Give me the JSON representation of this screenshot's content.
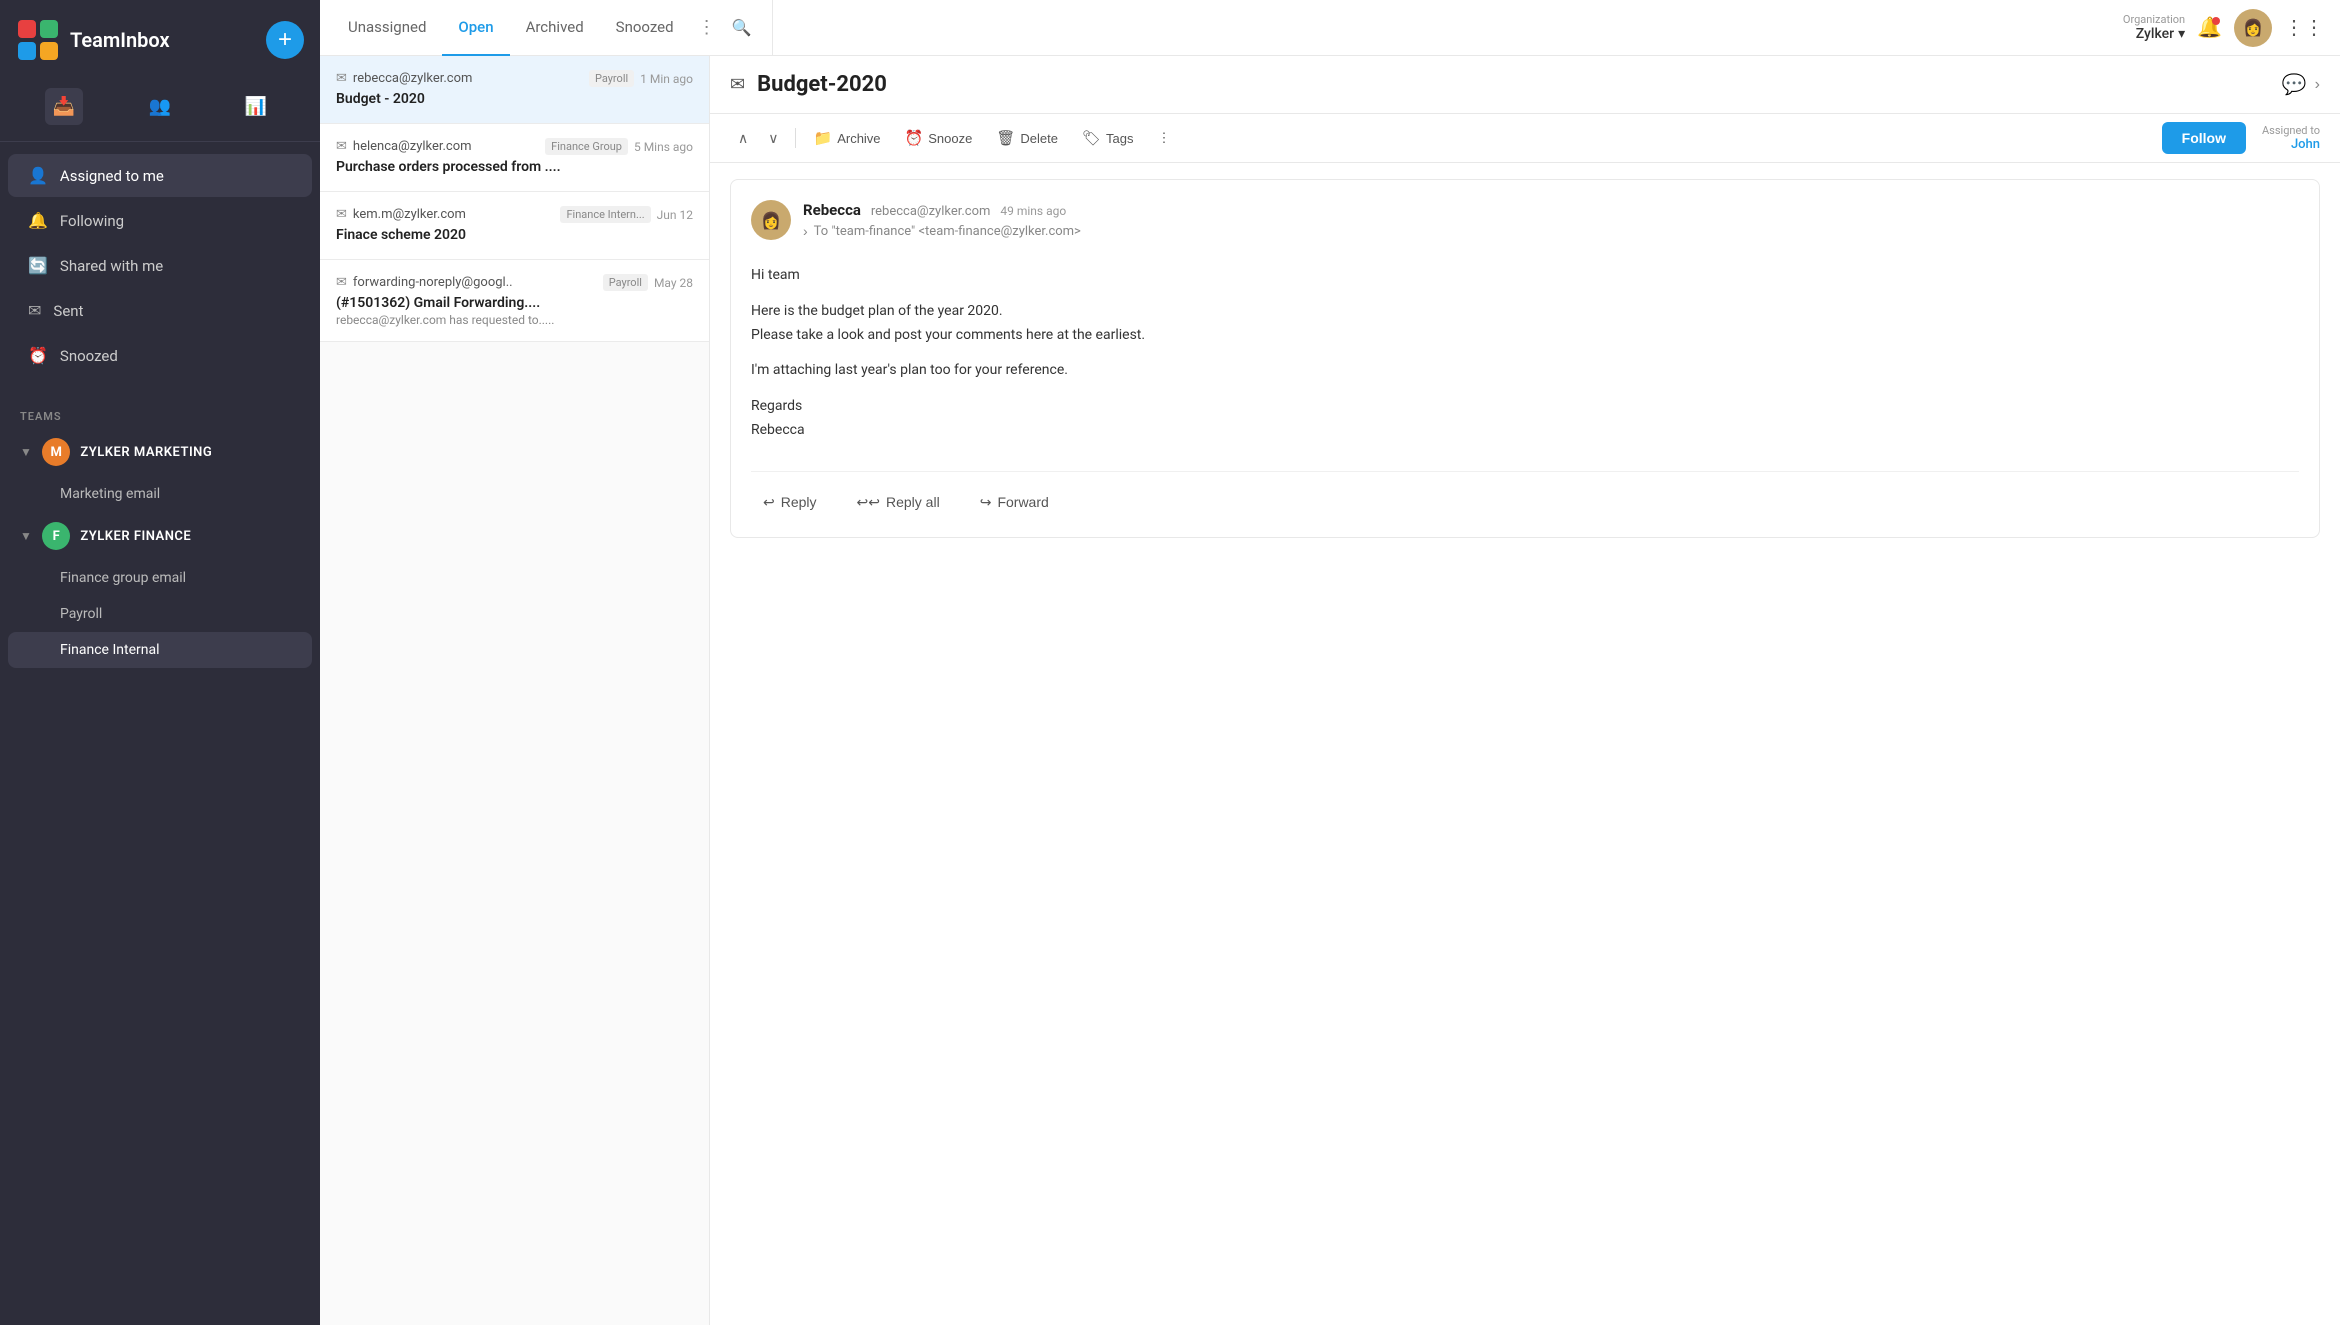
{
  "app": {
    "title": "TeamInbox",
    "add_button": "+",
    "organization": {
      "label": "Organization",
      "name": "Zylker"
    }
  },
  "sidebar": {
    "nav_items": [
      {
        "id": "assigned",
        "label": "Assigned to me",
        "icon": "👤"
      },
      {
        "id": "following",
        "label": "Following",
        "icon": "🔔"
      },
      {
        "id": "shared",
        "label": "Shared with me",
        "icon": "🔄"
      },
      {
        "id": "sent",
        "label": "Sent",
        "icon": "✉"
      },
      {
        "id": "snoozed",
        "label": "Snoozed",
        "icon": "⏰"
      }
    ],
    "teams_label": "TEAMS",
    "teams": [
      {
        "id": "marketing",
        "name": "ZYLKER MARKETING",
        "avatar_letter": "M",
        "avatar_color": "orange",
        "expanded": true,
        "items": [
          {
            "id": "marketing-email",
            "label": "Marketing email"
          }
        ]
      },
      {
        "id": "finance",
        "name": "ZYLKER FINANCE",
        "avatar_letter": "F",
        "avatar_color": "green",
        "expanded": true,
        "items": [
          {
            "id": "finance-group",
            "label": "Finance group email"
          },
          {
            "id": "payroll",
            "label": "Payroll"
          },
          {
            "id": "finance-internal",
            "label": "Finance Internal"
          }
        ]
      }
    ]
  },
  "tabs": {
    "items": [
      {
        "id": "unassigned",
        "label": "Unassigned"
      },
      {
        "id": "open",
        "label": "Open"
      },
      {
        "id": "archived",
        "label": "Archived"
      },
      {
        "id": "snoozed",
        "label": "Snoozed"
      }
    ],
    "active": "open"
  },
  "email_list": {
    "items": [
      {
        "id": "email-1",
        "from": "rebecca@zylker.com",
        "tag": "Payroll",
        "time": "1 Min ago",
        "subject": "Budget - 2020",
        "preview": "",
        "selected": true
      },
      {
        "id": "email-2",
        "from": "helenca@zylker.com",
        "tag": "Finance Group",
        "time": "5 Mins ago",
        "subject": "Purchase orders processed from ....",
        "preview": "",
        "selected": false
      },
      {
        "id": "email-3",
        "from": "kem.m@zylker.com",
        "tag": "Finance Intern...",
        "time": "Jun 12",
        "subject": "Finace scheme 2020",
        "preview": "",
        "selected": false
      },
      {
        "id": "email-4",
        "from": "forwarding-noreply@googl..",
        "tag": "Payroll",
        "time": "May 28",
        "subject": "(#1501362) Gmail Forwarding....",
        "preview": "rebecca@zylker.com has requested to.....",
        "selected": false
      }
    ]
  },
  "email_detail": {
    "title": "Budget-2020",
    "toolbar": {
      "archive_label": "Archive",
      "snooze_label": "Snooze",
      "delete_label": "Delete",
      "tags_label": "Tags",
      "follow_label": "Follow",
      "assigned_to_label": "Assigned to",
      "assigned_name": "John"
    },
    "message": {
      "sender_name": "Rebecca",
      "sender_email": "rebecca@zylker.com",
      "time": "49 mins ago",
      "recipient_label": "To \"team-finance\" <team-finance@zylker.com>",
      "body_lines": [
        "Hi team",
        "",
        "Here is the budget plan of the year 2020.",
        "Please take a look and post your comments here at the earliest.",
        "",
        "I'm attaching last year's plan too for your reference.",
        "",
        "",
        "Regards",
        "Rebecca"
      ],
      "actions": {
        "reply": "Reply",
        "reply_all": "Reply all",
        "forward": "Forward"
      }
    }
  }
}
